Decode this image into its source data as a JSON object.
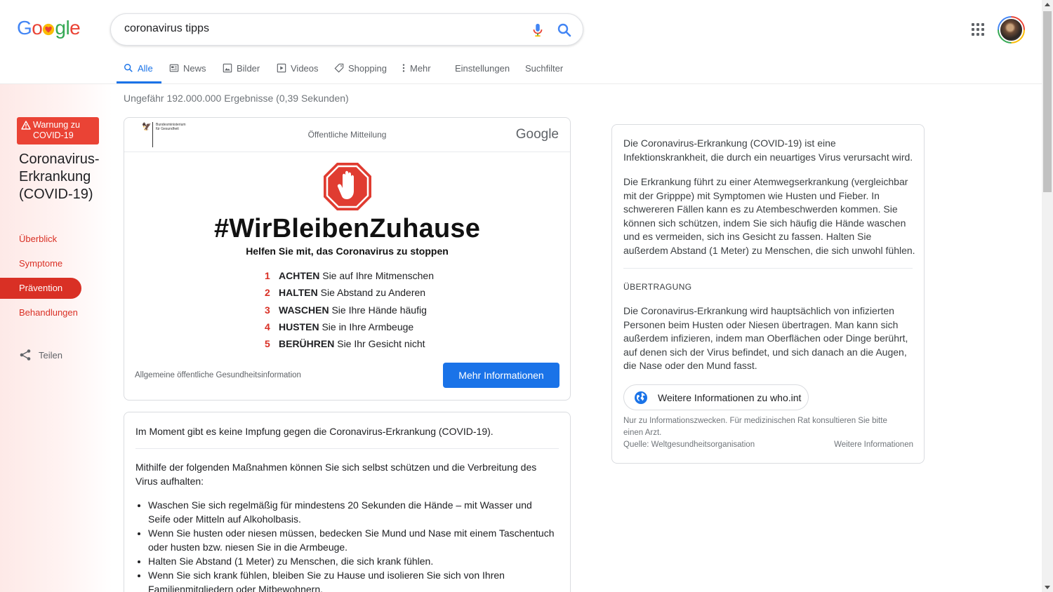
{
  "search": {
    "query": "coronavirus tipps",
    "logo_letters": [
      "G",
      "o",
      "",
      "g",
      "l",
      "e"
    ]
  },
  "tabs": [
    {
      "label": "Alle",
      "icon": "search-icon",
      "active": true
    },
    {
      "label": "News",
      "icon": "news-icon"
    },
    {
      "label": "Bilder",
      "icon": "image-icon"
    },
    {
      "label": "Videos",
      "icon": "video-icon"
    },
    {
      "label": "Shopping",
      "icon": "tag-icon"
    },
    {
      "label": "Mehr",
      "icon": "more-vert-icon"
    },
    {
      "label": "Einstellungen"
    },
    {
      "label": "Suchfilter"
    }
  ],
  "stats": "Ungefähr 192.000.000 Ergebnisse (0,39 Sekunden)",
  "sidebar": {
    "warning": "Warnung zu COVID-19",
    "title": "Coronavirus-Erkrankung (COVID-19)",
    "items": [
      "Überblick",
      "Symptome",
      "Prävention",
      "Behandlungen"
    ],
    "active": "Prävention",
    "share": "Teilen"
  },
  "psa": {
    "ministry_line1": "Bundesministerium",
    "ministry_line2": "für Gesundheit",
    "notice": "Öffentliche Mitteilung",
    "brand": "Google",
    "hashtag": "#WirBleibenZuhause",
    "subtitle": "Helfen Sie mit, das Coronavirus zu stoppen",
    "steps": [
      {
        "num": "1",
        "key": "ACHTEN",
        "text": " Sie auf Ihre Mitmenschen"
      },
      {
        "num": "2",
        "key": "HALTEN",
        "text": " Sie Abstand zu Anderen"
      },
      {
        "num": "3",
        "key": "WASCHEN",
        "text": " Sie Ihre Hände häufig"
      },
      {
        "num": "4",
        "key": "HUSTEN",
        "text": " Sie in Ihre Armbeuge"
      },
      {
        "num": "5",
        "key": "BERÜHREN",
        "text": " Sie Ihr Gesicht nicht"
      }
    ],
    "footer": "Allgemeine öffentliche Gesundheitsinformation",
    "button": "Mehr Informationen"
  },
  "prevention": {
    "intro": "Im Moment gibt es keine Impfung gegen die Coronavirus-Erkrankung (COVID-19).",
    "lead": "Mithilfe der folgenden Maßnahmen können Sie sich selbst schützen und die Verbreitung des Virus aufhalten:",
    "bullets": [
      "Waschen Sie sich regelmäßig für mindestens 20 Sekunden die Hände – mit Wasser und Seife oder Mitteln auf Alkoholbasis.",
      "Wenn Sie husten oder niesen müssen, bedecken Sie Mund und Nase mit einem Taschentuch oder husten bzw. niesen Sie in die Armbeuge.",
      "Halten Sie Abstand (1 Meter) zu Menschen, die sich krank fühlen.",
      "Wenn Sie sich krank fühlen, bleiben Sie zu Hause und isolieren Sie sich von Ihren Familienmitgliedern oder Mitbewohnern."
    ]
  },
  "knowledge": {
    "p1": "Die Coronavirus-Erkrankung (COVID-19) ist eine Infektionskrankheit, die durch ein neuartiges Virus verursacht wird.",
    "p2": "Die Erkrankung führt zu einer Atemwegserkrankung (vergleichbar mit der Gripppe) mit Symptomen wie Husten und Fieber. In schwereren Fällen kann es zu Atembeschwerden kommen. Sie können sich schützen, indem Sie sich häufig die Hände waschen und es vermeiden, sich ins Gesicht zu fassen. Halten Sie außerdem Abstand (1 Meter) zu Menschen, die sich unwohl fühlen.",
    "section": "ÜBERTRAGUNG",
    "p3": "Die Coronavirus-Erkrankung wird hauptsächlich von infizierten Personen beim Husten oder Niesen übertragen. Man kann sich außerdem infizieren, indem man Oberflächen oder Dinge berührt, auf denen sich der Virus befindet, und sich danach an die Augen, die Nase oder den Mund fasst.",
    "who_button": "Weitere Informationen zu who.int",
    "note": "Nur zu Informationszwecken. Für medizinischen Rat konsultieren Sie bitte einen Arzt.",
    "source": "Quelle: Weltgesundheitsorganisation",
    "more": "Weitere Informationen"
  },
  "colors": {
    "accent_blue": "#1a73e8",
    "alert_red": "#d93025",
    "warning_red": "#ea4335"
  }
}
